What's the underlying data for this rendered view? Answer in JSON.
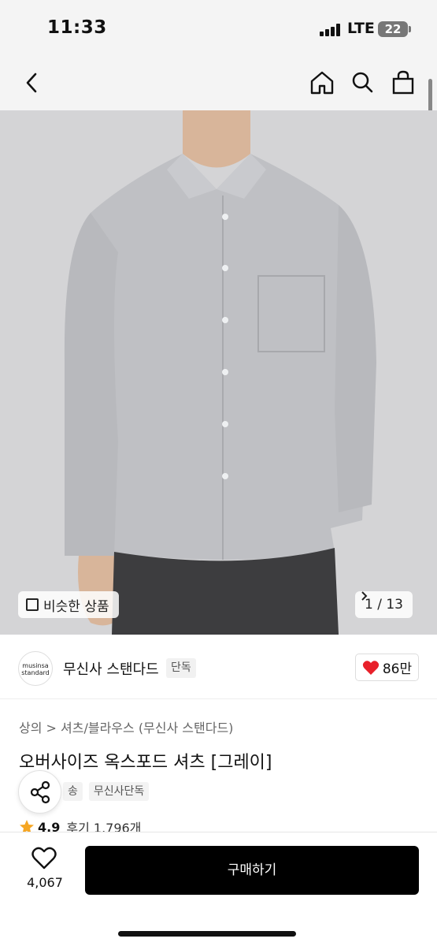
{
  "status_bar": {
    "time": "11:33",
    "network": "LTE",
    "battery": "22"
  },
  "gallery": {
    "similar_label": "비슷한 상품",
    "counter": "1 / 13"
  },
  "brand": {
    "logo_line1": "musinsa",
    "logo_line2": "standard",
    "name": "무신사 스탠다드",
    "tag": "단독",
    "like_count": "86만"
  },
  "product": {
    "breadcrumb": "상의 > 셔츠/블라우스 (무신사 스탠다드)",
    "title": "오버사이즈 옥스포드 셔츠 [그레이]",
    "tags": [
      "송",
      "무신사단독"
    ],
    "rating": "4.9",
    "reviews": "후기 1,796개"
  },
  "bottom_bar": {
    "wish_count": "4,067",
    "buy_label": "구매하기"
  },
  "colors": {
    "accent_red": "#e8202a",
    "star": "#f5a623",
    "buy_button": "#000000"
  },
  "icons": [
    "back-icon",
    "home-icon",
    "search-icon",
    "bag-icon",
    "similar-icon",
    "chevron-right-icon",
    "heart-filled-icon",
    "share-icon",
    "star-icon",
    "heart-outline-icon"
  ]
}
